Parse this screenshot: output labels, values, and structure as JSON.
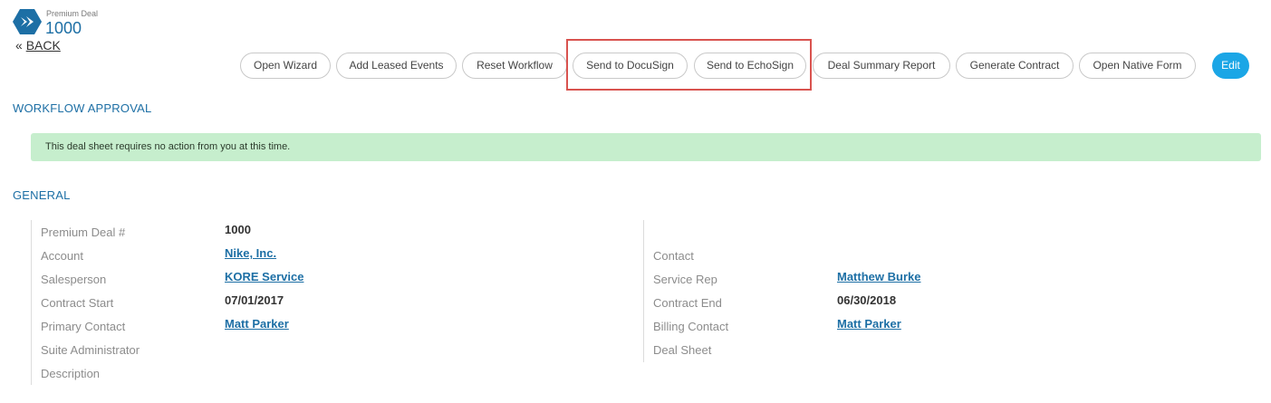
{
  "header": {
    "deal_type": "Premium Deal",
    "deal_number": "1000",
    "back_prefix": "«",
    "back_label": "BACK",
    "logo_icon": "kore-logo-icon"
  },
  "toolbar": {
    "open_wizard": "Open Wizard",
    "add_leased_events": "Add Leased Events",
    "reset_workflow": "Reset Workflow",
    "send_to_docusign": "Send to DocuSign",
    "send_to_echosign": "Send to EchoSign",
    "deal_summary_report": "Deal Summary Report",
    "generate_contract": "Generate Contract",
    "open_native_form": "Open Native Form",
    "edit": "Edit"
  },
  "workflow": {
    "title": "WORKFLOW APPROVAL",
    "message": "This deal sheet requires no action from you at this time."
  },
  "general": {
    "title": "GENERAL",
    "left": {
      "premium_deal_label": "Premium Deal #",
      "premium_deal_value": "1000",
      "account_label": "Account",
      "account_value": "Nike, Inc.",
      "salesperson_label": "Salesperson",
      "salesperson_value": "KORE Service",
      "contract_start_label": "Contract Start",
      "contract_start_value": "07/01/2017",
      "primary_contact_label": "Primary Contact",
      "primary_contact_value": "Matt Parker",
      "suite_admin_label": "Suite Administrator",
      "description_label": "Description"
    },
    "right": {
      "contact_label": "Contact",
      "service_rep_label": "Service Rep",
      "service_rep_value": "Matthew Burke",
      "contract_end_label": "Contract End",
      "contract_end_value": "06/30/2018",
      "billing_contact_label": "Billing Contact",
      "billing_contact_value": "Matt Parker",
      "deal_sheet_label": "Deal Sheet"
    }
  },
  "colors": {
    "accent": "#1d6fa5",
    "edit_button": "#1ba6e6",
    "alert_bg": "#c6eecd",
    "highlight": "#d9534f"
  }
}
